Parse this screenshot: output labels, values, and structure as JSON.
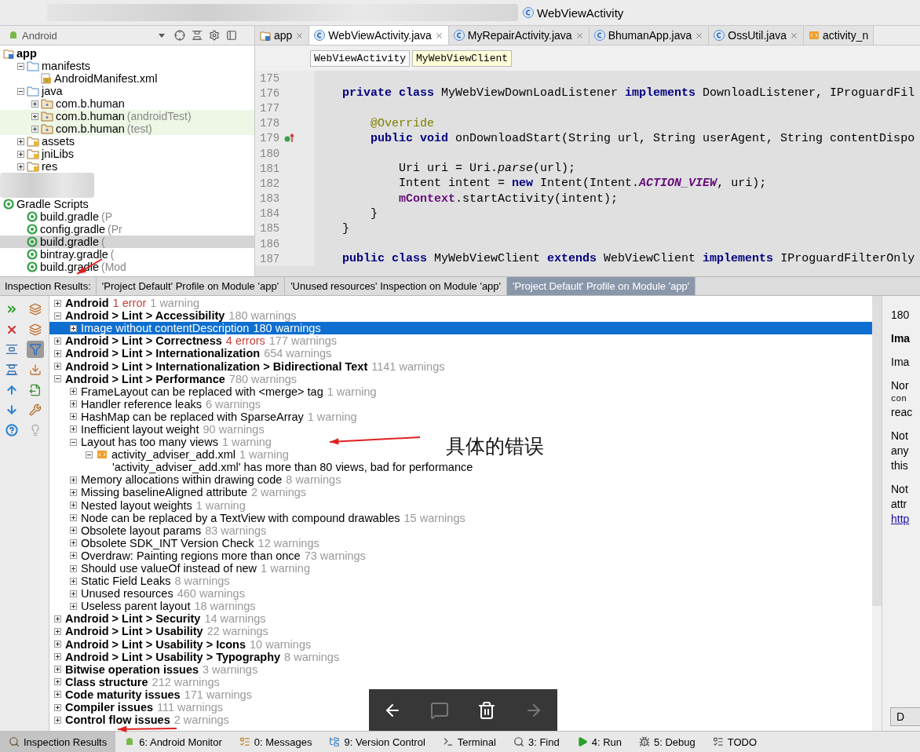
{
  "breadcrumb": [
    {
      "kind": "redacted"
    },
    {
      "kind": "class",
      "label": "WebViewActivity"
    }
  ],
  "project_panel": {
    "view": "Android",
    "tree": [
      {
        "kind": "module",
        "label": "app",
        "bold": true,
        "children": [
          {
            "kind": "folder",
            "label": "manifests",
            "expanded": true,
            "children": [
              {
                "kind": "manifest",
                "label": "AndroidManifest.xml"
              }
            ]
          },
          {
            "kind": "folder",
            "label": "java",
            "expanded": true,
            "children": [
              {
                "kind": "package",
                "label": "com.b.human",
                "expanded": false
              },
              {
                "kind": "package",
                "label": "com.b.human",
                "suffix": "(androidTest)",
                "highlighted": true,
                "expanded": false
              },
              {
                "kind": "package",
                "label": "com.b.human",
                "suffix": "(test)",
                "highlighted": true,
                "expanded": false
              }
            ]
          },
          {
            "kind": "resfolder",
            "label": "assets",
            "expanded": false
          },
          {
            "kind": "resfolder",
            "label": "jniLibs",
            "expanded": false
          },
          {
            "kind": "resfolder",
            "label": "res",
            "expanded": false
          }
        ]
      },
      {
        "kind": "redacted"
      },
      {
        "kind": "gradle",
        "label": "Gradle Scripts",
        "children": [
          {
            "kind": "gradle",
            "label": "build.gradle",
            "suffix": "(P"
          },
          {
            "kind": "gradle",
            "label": "config.gradle",
            "suffix": "(Pr"
          },
          {
            "kind": "gradle",
            "label": "build.gradle",
            "suffix": "(",
            "selected": true
          },
          {
            "kind": "gradle",
            "label": "bintray.gradle",
            "suffix": "("
          },
          {
            "kind": "gradle",
            "label": "build.gradle",
            "suffix": "(Mod"
          }
        ]
      }
    ]
  },
  "editor_tabs": [
    {
      "kind": "module",
      "label": "app",
      "selected": false,
      "closable": true
    },
    {
      "kind": "class",
      "label": "WebViewActivity.java",
      "selected": true,
      "closable": true
    },
    {
      "kind": "class",
      "label": "MyRepairActivity.java",
      "selected": false,
      "closable": true
    },
    {
      "kind": "class",
      "label": "BhumanApp.java",
      "selected": false,
      "closable": true
    },
    {
      "kind": "class",
      "label": "OssUtil.java",
      "selected": false,
      "closable": true
    },
    {
      "kind": "layout",
      "label": "activity_n",
      "selected": false,
      "closable": false
    }
  ],
  "structure_path": [
    {
      "label": "WebViewActivity",
      "selected": false
    },
    {
      "label": "MyWebViewClient",
      "selected": true
    }
  ],
  "code_lines": [
    {
      "number": "175"
    },
    {
      "number": "176",
      "tokens": [
        {
          "kind": "keyword",
          "text": "    private class"
        },
        {
          "kind": "plain",
          "text": " MyWebViewDownLoadListener "
        },
        {
          "kind": "keyword",
          "text": "implements"
        },
        {
          "kind": "plain",
          "text": " DownloadListener, IProguardFil"
        }
      ]
    },
    {
      "number": "177"
    },
    {
      "number": "178",
      "tokens": [
        {
          "kind": "annotation",
          "text": "        @Override"
        }
      ]
    },
    {
      "number": "179",
      "override_marker": true,
      "tokens": [
        {
          "kind": "keyword",
          "text": "        public void"
        },
        {
          "kind": "plain",
          "text": " onDownloadStart(String url, String userAgent, String contentDispo"
        }
      ]
    },
    {
      "number": "180"
    },
    {
      "number": "181",
      "tokens": [
        {
          "kind": "plain",
          "text": "            Uri uri = Uri."
        },
        {
          "kind": "italic",
          "text": "parse"
        },
        {
          "kind": "plain",
          "text": "(url);"
        }
      ]
    },
    {
      "number": "182",
      "tokens": [
        {
          "kind": "plain",
          "text": "            Intent intent = "
        },
        {
          "kind": "keyword",
          "text": "new"
        },
        {
          "kind": "plain",
          "text": " Intent(Intent."
        },
        {
          "kind": "static",
          "text": "ACTION_VIEW"
        },
        {
          "kind": "plain",
          "text": ", uri);"
        }
      ]
    },
    {
      "number": "183",
      "tokens": [
        {
          "kind": "field",
          "text": "            mContext"
        },
        {
          "kind": "plain",
          "text": ".startActivity(intent);"
        }
      ]
    },
    {
      "number": "184",
      "tokens": [
        {
          "kind": "plain",
          "text": "        }"
        }
      ]
    },
    {
      "number": "185",
      "tokens": [
        {
          "kind": "plain",
          "text": "    }"
        }
      ]
    },
    {
      "number": "186"
    },
    {
      "number": "187",
      "tokens": [
        {
          "kind": "keyword",
          "text": "    public class"
        },
        {
          "kind": "plain",
          "text": " MyWebViewClient "
        },
        {
          "kind": "keyword",
          "text": "extends"
        },
        {
          "kind": "plain",
          "text": " WebViewClient "
        },
        {
          "kind": "keyword",
          "text": "implements"
        },
        {
          "kind": "plain",
          "text": " IProguardFilterOnly"
        }
      ]
    }
  ],
  "inspection": {
    "title": "Inspection Results:",
    "tabs": [
      {
        "label": "'Project Default' Profile on Module 'app'",
        "selected": false
      },
      {
        "label": "'Unused resources' Inspection on Module 'app'",
        "selected": false
      },
      {
        "label": "'Project Default' Profile on Module 'app'",
        "selected": true
      }
    ],
    "tools": [
      {
        "kind": "rerun",
        "toggled": false
      },
      {
        "kind": "group",
        "toggled": false
      },
      {
        "kind": "close",
        "toggled": false
      },
      {
        "kind": "group2",
        "toggled": false
      },
      {
        "kind": "expand",
        "toggled": false
      },
      {
        "kind": "filter",
        "toggled": true
      },
      {
        "kind": "collapse",
        "toggled": false
      },
      {
        "kind": "export",
        "toggled": false
      },
      {
        "kind": "up",
        "toggled": false
      },
      {
        "kind": "open",
        "toggled": false
      },
      {
        "kind": "down",
        "toggled": false
      },
      {
        "kind": "fix",
        "toggled": false
      },
      {
        "kind": "help",
        "toggled": false
      },
      {
        "kind": "bulb",
        "toggled": false
      }
    ],
    "tree": [
      {
        "kind": "group",
        "label": "Android",
        "expanded": false,
        "selected": false,
        "counts": [
          {
            "kind": "error",
            "text": "1 error"
          },
          {
            "kind": "warning",
            "text": "1 warning"
          }
        ]
      },
      {
        "kind": "group",
        "label": "Android > Lint > Accessibility",
        "expanded": true,
        "selected": false,
        "counts": [
          {
            "kind": "warning",
            "text": "180 warnings"
          }
        ],
        "children": [
          {
            "kind": "item",
            "label": "Image without contentDescription",
            "expanded": false,
            "selected": true,
            "counts": [
              {
                "kind": "warning",
                "text": "180 warnings"
              }
            ]
          }
        ]
      },
      {
        "kind": "group",
        "label": "Android > Lint > Correctness",
        "expanded": false,
        "selected": false,
        "counts": [
          {
            "kind": "error",
            "text": "4 errors"
          },
          {
            "kind": "warning",
            "text": "177 warnings"
          }
        ]
      },
      {
        "kind": "group",
        "label": "Android > Lint > Internationalization",
        "expanded": false,
        "selected": false,
        "counts": [
          {
            "kind": "warning",
            "text": "654 warnings"
          }
        ]
      },
      {
        "kind": "group",
        "label": "Android > Lint > Internationalization > Bidirectional Text",
        "expanded": false,
        "selected": false,
        "counts": [
          {
            "kind": "warning",
            "text": "1141 warnings"
          }
        ]
      },
      {
        "kind": "group",
        "label": "Android > Lint > Performance",
        "expanded": true,
        "selected": false,
        "counts": [
          {
            "kind": "warning",
            "text": "780 warnings"
          }
        ],
        "children": [
          {
            "kind": "item",
            "label": "FrameLayout can be replaced with <merge> tag",
            "expanded": false,
            "selected": false,
            "counts": [
              {
                "kind": "warning",
                "text": "1 warning"
              }
            ]
          },
          {
            "kind": "item",
            "label": "Handler reference leaks",
            "expanded": false,
            "selected": false,
            "counts": [
              {
                "kind": "warning",
                "text": "6 warnings"
              }
            ]
          },
          {
            "kind": "item",
            "label": "HashMap can be replaced with SparseArray",
            "expanded": false,
            "selected": false,
            "counts": [
              {
                "kind": "warning",
                "text": "1 warning"
              }
            ]
          },
          {
            "kind": "item",
            "label": "Inefficient layout weight",
            "expanded": false,
            "selected": false,
            "counts": [
              {
                "kind": "warning",
                "text": "90 warnings"
              }
            ]
          },
          {
            "kind": "item",
            "label": "Layout has too many views",
            "expanded": true,
            "selected": false,
            "counts": [
              {
                "kind": "warning",
                "text": "1 warning"
              }
            ],
            "children": [
              {
                "kind": "file",
                "label": "activity_adviser_add.xml",
                "expanded": true,
                "selected": false,
                "counts": [
                  {
                    "kind": "warning",
                    "text": "1 warning"
                  }
                ],
                "children": [
                  {
                    "kind": "problem",
                    "label": "'activity_adviser_add.xml' has more than 80 views, bad for performance",
                    "selected": false
                  }
                ]
              }
            ]
          },
          {
            "kind": "item",
            "label": "Memory allocations within drawing code",
            "expanded": false,
            "selected": false,
            "counts": [
              {
                "kind": "warning",
                "text": "8 warnings"
              }
            ]
          },
          {
            "kind": "item",
            "label": "Missing baselineAligned attribute",
            "expanded": false,
            "selected": false,
            "counts": [
              {
                "kind": "warning",
                "text": "2 warnings"
              }
            ]
          },
          {
            "kind": "item",
            "label": "Nested layout weights",
            "expanded": false,
            "selected": false,
            "counts": [
              {
                "kind": "warning",
                "text": "1 warning"
              }
            ]
          },
          {
            "kind": "item",
            "label": "Node can be replaced by a TextView with compound drawables",
            "expanded": false,
            "selected": false,
            "counts": [
              {
                "kind": "warning",
                "text": "15 warnings"
              }
            ]
          },
          {
            "kind": "item",
            "label": "Obsolete layout params",
            "expanded": false,
            "selected": false,
            "counts": [
              {
                "kind": "warning",
                "text": "83 warnings"
              }
            ]
          },
          {
            "kind": "item",
            "label": "Obsolete SDK_INT Version Check",
            "expanded": false,
            "selected": false,
            "counts": [
              {
                "kind": "warning",
                "text": "12 warnings"
              }
            ]
          },
          {
            "kind": "item",
            "label": "Overdraw: Painting regions more than once",
            "expanded": false,
            "selected": false,
            "counts": [
              {
                "kind": "warning",
                "text": "73 warnings"
              }
            ]
          },
          {
            "kind": "item",
            "label": "Should use valueOf instead of new",
            "expanded": false,
            "selected": false,
            "counts": [
              {
                "kind": "warning",
                "text": "1 warning"
              }
            ]
          },
          {
            "kind": "item",
            "label": "Static Field Leaks",
            "expanded": false,
            "selected": false,
            "counts": [
              {
                "kind": "warning",
                "text": "8 warnings"
              }
            ]
          },
          {
            "kind": "item",
            "label": "Unused resources",
            "expanded": false,
            "selected": false,
            "counts": [
              {
                "kind": "warning",
                "text": "460 warnings"
              }
            ]
          },
          {
            "kind": "item",
            "label": "Useless parent layout",
            "expanded": false,
            "selected": false,
            "counts": [
              {
                "kind": "warning",
                "text": "18 warnings"
              }
            ]
          }
        ]
      },
      {
        "kind": "group",
        "label": "Android > Lint > Security",
        "expanded": false,
        "selected": false,
        "counts": [
          {
            "kind": "warning",
            "text": "14 warnings"
          }
        ]
      },
      {
        "kind": "group",
        "label": "Android > Lint > Usability",
        "expanded": false,
        "selected": false,
        "counts": [
          {
            "kind": "warning",
            "text": "22 warnings"
          }
        ]
      },
      {
        "kind": "group",
        "label": "Android > Lint > Usability > Icons",
        "expanded": false,
        "selected": false,
        "counts": [
          {
            "kind": "warning",
            "text": "10 warnings"
          }
        ]
      },
      {
        "kind": "group",
        "label": "Android > Lint > Usability > Typography",
        "expanded": false,
        "selected": false,
        "counts": [
          {
            "kind": "warning",
            "text": "8 warnings"
          }
        ]
      },
      {
        "kind": "group",
        "label": "Bitwise operation issues",
        "expanded": false,
        "selected": false,
        "counts": [
          {
            "kind": "warning",
            "text": "3 warnings"
          }
        ]
      },
      {
        "kind": "group",
        "label": "Class structure",
        "expanded": false,
        "selected": false,
        "counts": [
          {
            "kind": "warning",
            "text": "212 warnings"
          }
        ]
      },
      {
        "kind": "group",
        "label": "Code maturity issues",
        "expanded": false,
        "selected": false,
        "counts": [
          {
            "kind": "warning",
            "text": "171 warnings"
          }
        ]
      },
      {
        "kind": "group",
        "label": "Compiler issues",
        "expanded": false,
        "selected": false,
        "counts": [
          {
            "kind": "warning",
            "text": "111 warnings"
          }
        ]
      },
      {
        "kind": "group",
        "label": "Control flow issues",
        "expanded": false,
        "selected": false,
        "counts": [
          {
            "kind": "warning",
            "text": "2 warnings"
          }
        ]
      }
    ],
    "details": {
      "paragraphs": [
        {
          "lines": [
            {
              "kind": "plain",
              "text": "180"
            }
          ]
        },
        {
          "lines": [
            {
              "kind": "heading",
              "text": "Ima"
            }
          ]
        },
        {
          "lines": [
            {
              "kind": "plain",
              "text": "Ima"
            }
          ]
        },
        {
          "lines": [
            {
              "kind": "plain",
              "text": "Nor"
            },
            {
              "kind": "code",
              "text": "con"
            },
            {
              "kind": "plain",
              "text": "reac"
            }
          ]
        },
        {
          "lines": [
            {
              "kind": "plain",
              "text": "Not"
            },
            {
              "kind": "plain",
              "text": "any"
            },
            {
              "kind": "plain",
              "text": "this"
            }
          ]
        },
        {
          "lines": [
            {
              "kind": "plain",
              "text": "Not"
            },
            {
              "kind": "plain",
              "text": "attr"
            },
            {
              "kind": "link",
              "text": "http"
            }
          ]
        }
      ],
      "button": "D"
    }
  },
  "tool_windows": [
    {
      "kind": "inspect",
      "label": "Inspection Results",
      "selected": true
    },
    {
      "kind": "android",
      "label": "6: Android Monitor",
      "selected": false
    },
    {
      "kind": "messages",
      "label": "0: Messages",
      "selected": false
    },
    {
      "kind": "vcs",
      "label": "9: Version Control",
      "selected": false
    },
    {
      "kind": "terminal",
      "label": "Terminal",
      "selected": false
    },
    {
      "kind": "find",
      "label": "3: Find",
      "selected": false
    },
    {
      "kind": "run",
      "label": "4: Run",
      "selected": false
    },
    {
      "kind": "debug",
      "label": "5: Debug",
      "selected": false
    },
    {
      "kind": "todo",
      "label": "TODO",
      "selected": false
    }
  ],
  "viewer_toolbar": [
    {
      "kind": "back",
      "disabled": false
    },
    {
      "kind": "comment",
      "disabled": true
    },
    {
      "kind": "delete",
      "disabled": false
    },
    {
      "kind": "forward",
      "disabled": true
    }
  ],
  "annotations": [
    {
      "kind": "arrow_label",
      "text": "具体的错误"
    },
    {
      "kind": "arrow"
    },
    {
      "kind": "arrow"
    }
  ]
}
